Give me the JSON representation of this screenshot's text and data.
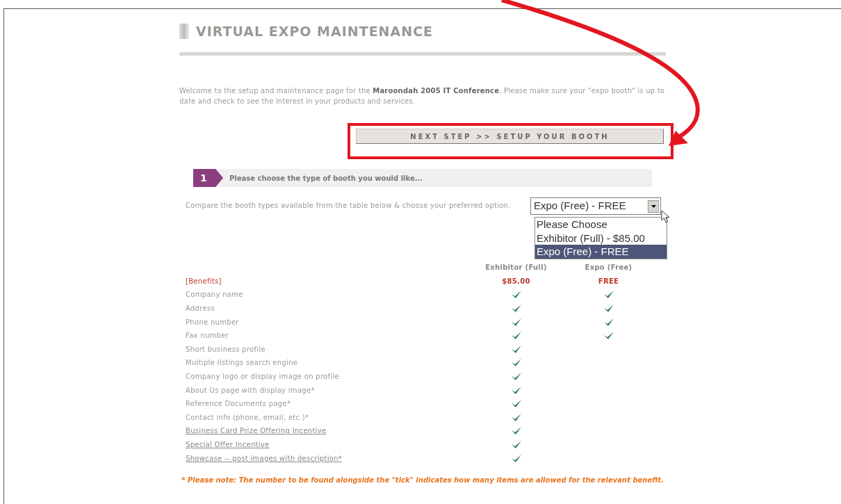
{
  "page": {
    "title": "VIRTUAL EXPO MAINTENANCE",
    "intro": "Welcome to the setup and maintenance page for the **Maroondah 2005 IT Conference**. Please make sure your \"expo booth\" is up to date and check to see the interest in your products and services.",
    "next_button": "NEXT STEP >> SETUP YOUR BOOTH"
  },
  "step": {
    "number": "1",
    "label": "Please choose the type of booth you would like..."
  },
  "booth_choice": {
    "prompt": "Compare the booth types available from the table below & choose your preferred option.",
    "value": "Expo (Free) - FREE",
    "expanded": true,
    "options": [
      {
        "label": "Please Choose",
        "selected": false
      },
      {
        "label": "Exhibitor (Full) - $85.00",
        "selected": false
      },
      {
        "label": "Expo (Free) - FREE",
        "selected": true
      }
    ]
  },
  "table": {
    "columns": [
      "Exhibitor (Full)",
      "Expo (Free)"
    ],
    "heading": "[Benefits]",
    "prices": [
      "$85.00",
      "FREE"
    ],
    "rows": [
      {
        "label": "Company name",
        "link": false,
        "exhibitor": true,
        "expo": true
      },
      {
        "label": "Address",
        "link": false,
        "exhibitor": true,
        "expo": true
      },
      {
        "label": "Phone number",
        "link": false,
        "exhibitor": true,
        "expo": true
      },
      {
        "label": "Fax number",
        "link": false,
        "exhibitor": true,
        "expo": true
      },
      {
        "label": "Short business profile",
        "link": false,
        "exhibitor": true,
        "expo": false
      },
      {
        "label": "Multiple listings search engine",
        "link": false,
        "exhibitor": true,
        "expo": false
      },
      {
        "label": "Company logo or display image on profile",
        "link": false,
        "exhibitor": true,
        "expo": false
      },
      {
        "label": "About Us page with display image*",
        "link": false,
        "exhibitor": true,
        "expo": false
      },
      {
        "label": "Reference Documents page*",
        "link": false,
        "exhibitor": true,
        "expo": false
      },
      {
        "label": "Contact info (phone, email, etc.)*",
        "link": false,
        "exhibitor": true,
        "expo": false
      },
      {
        "label": "Business Card Prize Offering Incentive",
        "link": true,
        "exhibitor": true,
        "expo": false
      },
      {
        "label": "Special Offer Incentive",
        "link": true,
        "exhibitor": true,
        "expo": false
      },
      {
        "label": "Showcase -- post images with description*",
        "link": true,
        "exhibitor": true,
        "expo": false
      }
    ]
  },
  "note": "* Please note: The number to be found alongside the \"tick\" indicates how many items are allowed for the relevant benefit."
}
